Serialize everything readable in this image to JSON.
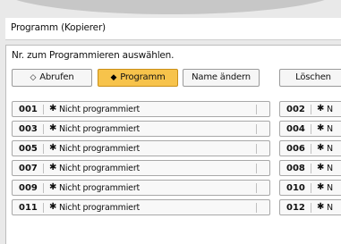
{
  "window": {
    "title": "Programm (Kopierer)"
  },
  "instruction": "Nr. zum Programmieren auswählen.",
  "tabs": [
    {
      "label": "Abrufen",
      "icon": "◇",
      "active": false
    },
    {
      "label": "Programm",
      "icon": "◆",
      "active": true
    },
    {
      "label": "Name ändern",
      "icon": "",
      "active": false
    },
    {
      "label": "Löschen",
      "icon": "",
      "active": false
    }
  ],
  "programs_left": [
    {
      "number": "001",
      "label": "Nicht programmiert"
    },
    {
      "number": "003",
      "label": "Nicht programmiert"
    },
    {
      "number": "005",
      "label": "Nicht programmiert"
    },
    {
      "number": "007",
      "label": "Nicht programmiert"
    },
    {
      "number": "009",
      "label": "Nicht programmiert"
    },
    {
      "number": "011",
      "label": "Nicht programmiert"
    }
  ],
  "programs_right": [
    {
      "number": "002",
      "label": "N"
    },
    {
      "number": "004",
      "label": "N"
    },
    {
      "number": "006",
      "label": "N"
    },
    {
      "number": "008",
      "label": "N"
    },
    {
      "number": "010",
      "label": "N"
    },
    {
      "number": "012",
      "label": "N"
    }
  ],
  "colors": {
    "active_tab": "#f7c34b",
    "background": "#e9e9e9"
  }
}
